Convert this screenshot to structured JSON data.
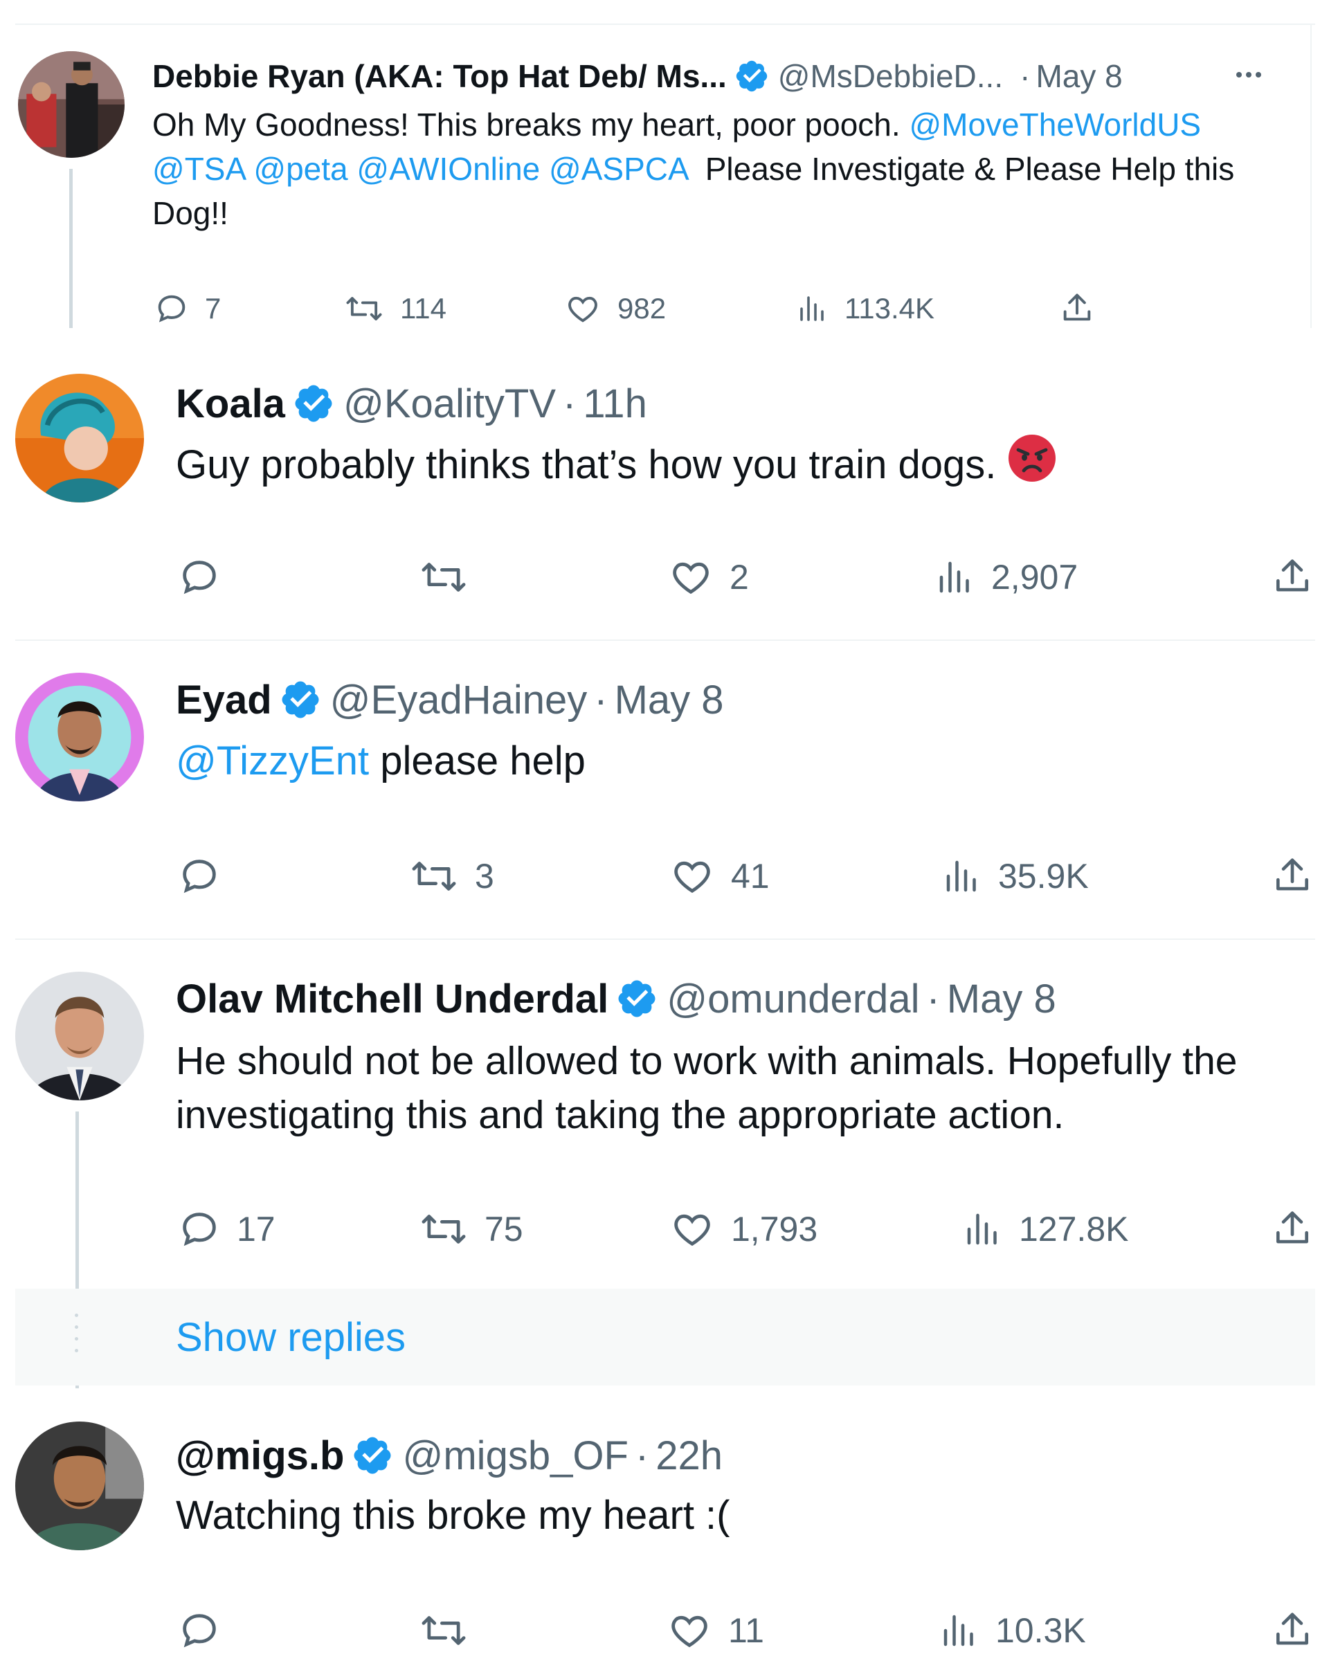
{
  "tweets": [
    {
      "name": "Debbie Ryan (AKA: Top Hat Deb/ Ms...",
      "handle": "@MsDebbieD...",
      "separator": "·",
      "time": "May 8",
      "text_segments": [
        {
          "text": "Oh My Goodness! This breaks my heart, poor pooch. ",
          "mention": false
        },
        {
          "text": "@MoveTheWorldUS",
          "mention": true
        }
      ],
      "text_line2": [
        {
          "text": "@TSA",
          "mention": true
        },
        {
          "text": " ",
          "mention": false
        },
        {
          "text": "@peta",
          "mention": true
        },
        {
          "text": " ",
          "mention": false
        },
        {
          "text": "@AWIOnline",
          "mention": true
        },
        {
          "text": " ",
          "mention": false
        },
        {
          "text": "@ASPCA",
          "mention": true
        },
        {
          "text": "  Please Investigate & Please Help this",
          "mention": false
        }
      ],
      "text_line3": "Dog!!",
      "replies": "7",
      "retweets": "114",
      "likes": "982",
      "views": "113.4K"
    },
    {
      "name": "Koala",
      "handle": "@KoalityTV",
      "separator": "·",
      "time": "11h",
      "text": "Guy probably thinks that’s how you train dogs.",
      "replies": "",
      "retweets": "",
      "likes": "2",
      "views": "2,907"
    },
    {
      "name": "Eyad",
      "handle": "@EyadHainey",
      "separator": "·",
      "time": "May 8",
      "mention": "@TizzyEnt",
      "text": " please help",
      "replies": "",
      "retweets": "3",
      "likes": "41",
      "views": "35.9K"
    },
    {
      "name": "Olav Mitchell Underdal",
      "handle": "@omunderdal",
      "separator": "·",
      "time": "May 8",
      "text_line1": "He should not be allowed to work with animals. Hopefully the",
      "text_line2": "investigating this and taking the appropriate action.",
      "replies": "17",
      "retweets": "75",
      "likes": "1,793",
      "views": "127.8K"
    },
    {
      "name": "@migs.b",
      "handle": "@migsb_OF",
      "separator": "·",
      "time": "22h",
      "text": "Watching this broke my heart :(",
      "replies": "",
      "retweets": "",
      "likes": "11",
      "views": "10.3K"
    }
  ],
  "show_replies": "Show replies",
  "colors": {
    "accent": "#1d9bf0",
    "text": "#0f1419",
    "secondary": "#536471",
    "line": "#cfd9de",
    "divider": "#eff3f4"
  }
}
